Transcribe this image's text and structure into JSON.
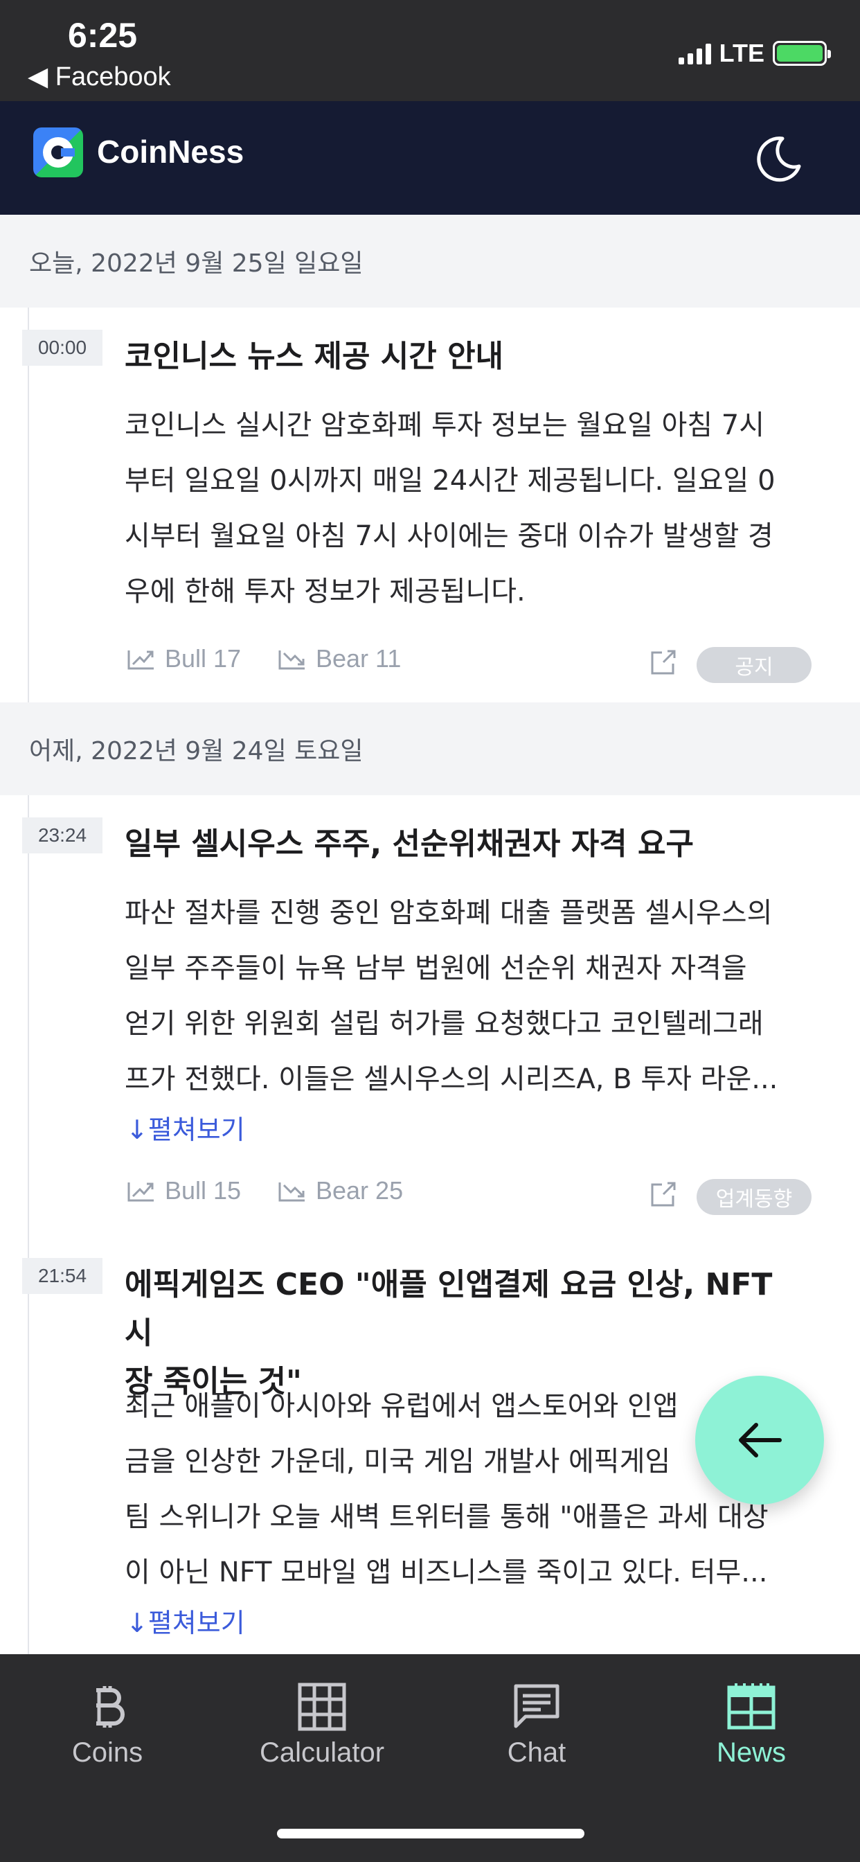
{
  "status_bar": {
    "time": "6:25",
    "back_label": "◀ Facebook",
    "network": "LTE"
  },
  "header": {
    "brand": "CoinNess",
    "theme_toggle_icon": "moon-icon"
  },
  "sections": [
    {
      "date_label": "오늘, 2022년 9월 25일 일요일",
      "items": [
        {
          "time": "00:00",
          "title": "코인니스 뉴스 제공 시간 안내",
          "body_lines": [
            "코인니스 실시간 암호화폐 투자 정보는 월요일 아침 7시",
            "부터 일요일 0시까지 매일 24시간 제공됩니다. 일요일 0",
            "시부터 월요일 아침 7시 사이에는 중대 이슈가 발생할 경",
            "우에 한해 투자 정보가 제공됩니다."
          ],
          "bull": "Bull 17",
          "bear": "Bear 11",
          "tag": "공지"
        }
      ]
    },
    {
      "date_label": "어제, 2022년 9월 24일 토요일",
      "items": [
        {
          "time": "23:24",
          "title": "일부 셀시우스 주주, 선순위채권자 자격 요구",
          "body_lines": [
            "파산 절차를 진행 중인 암호화폐 대출 플랫폼 셀시우스의",
            "일부 주주들이 뉴욕 남부 법원에 선순위 채권자 자격을",
            "얻기 위한 위원회 설립 허가를 요청했다고 코인텔레그래",
            "프가 전했다. 이들은 셀시우스의 시리즈A, B 투자 라운..."
          ],
          "expand": "↓펼쳐보기",
          "bull": "Bull 15",
          "bear": "Bear 25",
          "tag": "업계동향"
        },
        {
          "time": "21:54",
          "title_lines": [
            "에픽게임즈 CEO \"애플 인앱결제 요금 인상, NFT 시",
            "장 죽이는 것\""
          ],
          "body_lines": [
            "최근 애플이 아시아와 유럽에서 앱스토어와 인앱",
            "금을 인상한 가운데, 미국 게임 개발사 에픽게임",
            "팀 스위니가 오늘 새벽 트위터를 통해 \"애플은 과세 대상",
            "이 아닌 NFT 모바일 앱 비즈니스를 죽이고 있다. 터무..."
          ],
          "expand": "↓펼쳐보기"
        }
      ]
    }
  ],
  "fab": {
    "icon": "arrow-left-icon"
  },
  "bottom_nav": [
    {
      "label": "Coins",
      "icon": "bitcoin-icon"
    },
    {
      "label": "Calculator",
      "icon": "grid-icon"
    },
    {
      "label": "Chat",
      "icon": "chat-icon"
    },
    {
      "label": "News",
      "icon": "news-icon",
      "active": true
    }
  ],
  "colors": {
    "header_bg": "#151b33",
    "accent": "#8ef2d6",
    "link": "#3b5bdb"
  }
}
